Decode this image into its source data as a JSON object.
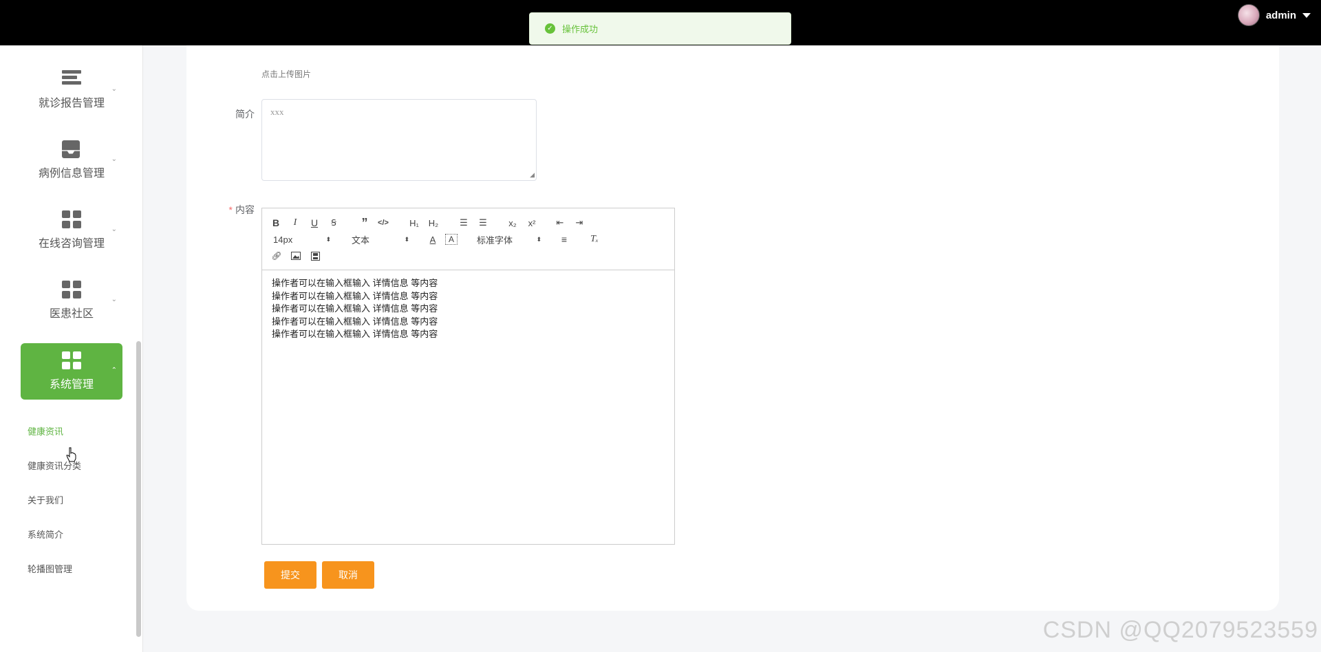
{
  "header": {
    "username": "admin"
  },
  "toast": {
    "message": "操作成功",
    "color": "#67c23a"
  },
  "sidebar": {
    "menu": [
      {
        "label": "就诊报告管理",
        "icon": "list-icon"
      },
      {
        "label": "病例信息管理",
        "icon": "inbox-icon"
      },
      {
        "label": "在线咨询管理",
        "icon": "grid-icon"
      },
      {
        "label": "医患社区",
        "icon": "grid-icon"
      },
      {
        "label": "系统管理",
        "icon": "grid-icon",
        "active": true
      }
    ],
    "submenu": [
      {
        "label": "健康资讯",
        "active": true
      },
      {
        "label": "健康资讯分类"
      },
      {
        "label": "关于我们"
      },
      {
        "label": "系统简介"
      },
      {
        "label": "轮播图管理"
      }
    ],
    "accent_color": "#5fb442"
  },
  "form": {
    "upload_hint": "点击上传图片",
    "intro_label": "简介",
    "intro_value": "xxx",
    "content_label": "内容",
    "content_required_mark": "*",
    "editor": {
      "font_size": "14px",
      "heading": "文本",
      "font_family": "标准字体",
      "lines": [
        "操作者可以在输入框输入  详情信息  等内容",
        "操作者可以在输入框输入  详情信息  等内容",
        "操作者可以在输入框输入  详情信息  等内容",
        "操作者可以在输入框输入  详情信息  等内容",
        "操作者可以在输入框输入  详情信息  等内容"
      ]
    },
    "submit_label": "提交",
    "cancel_label": "取消",
    "button_color": "#f7941d"
  },
  "watermark": "CSDN @QQ2079523559"
}
